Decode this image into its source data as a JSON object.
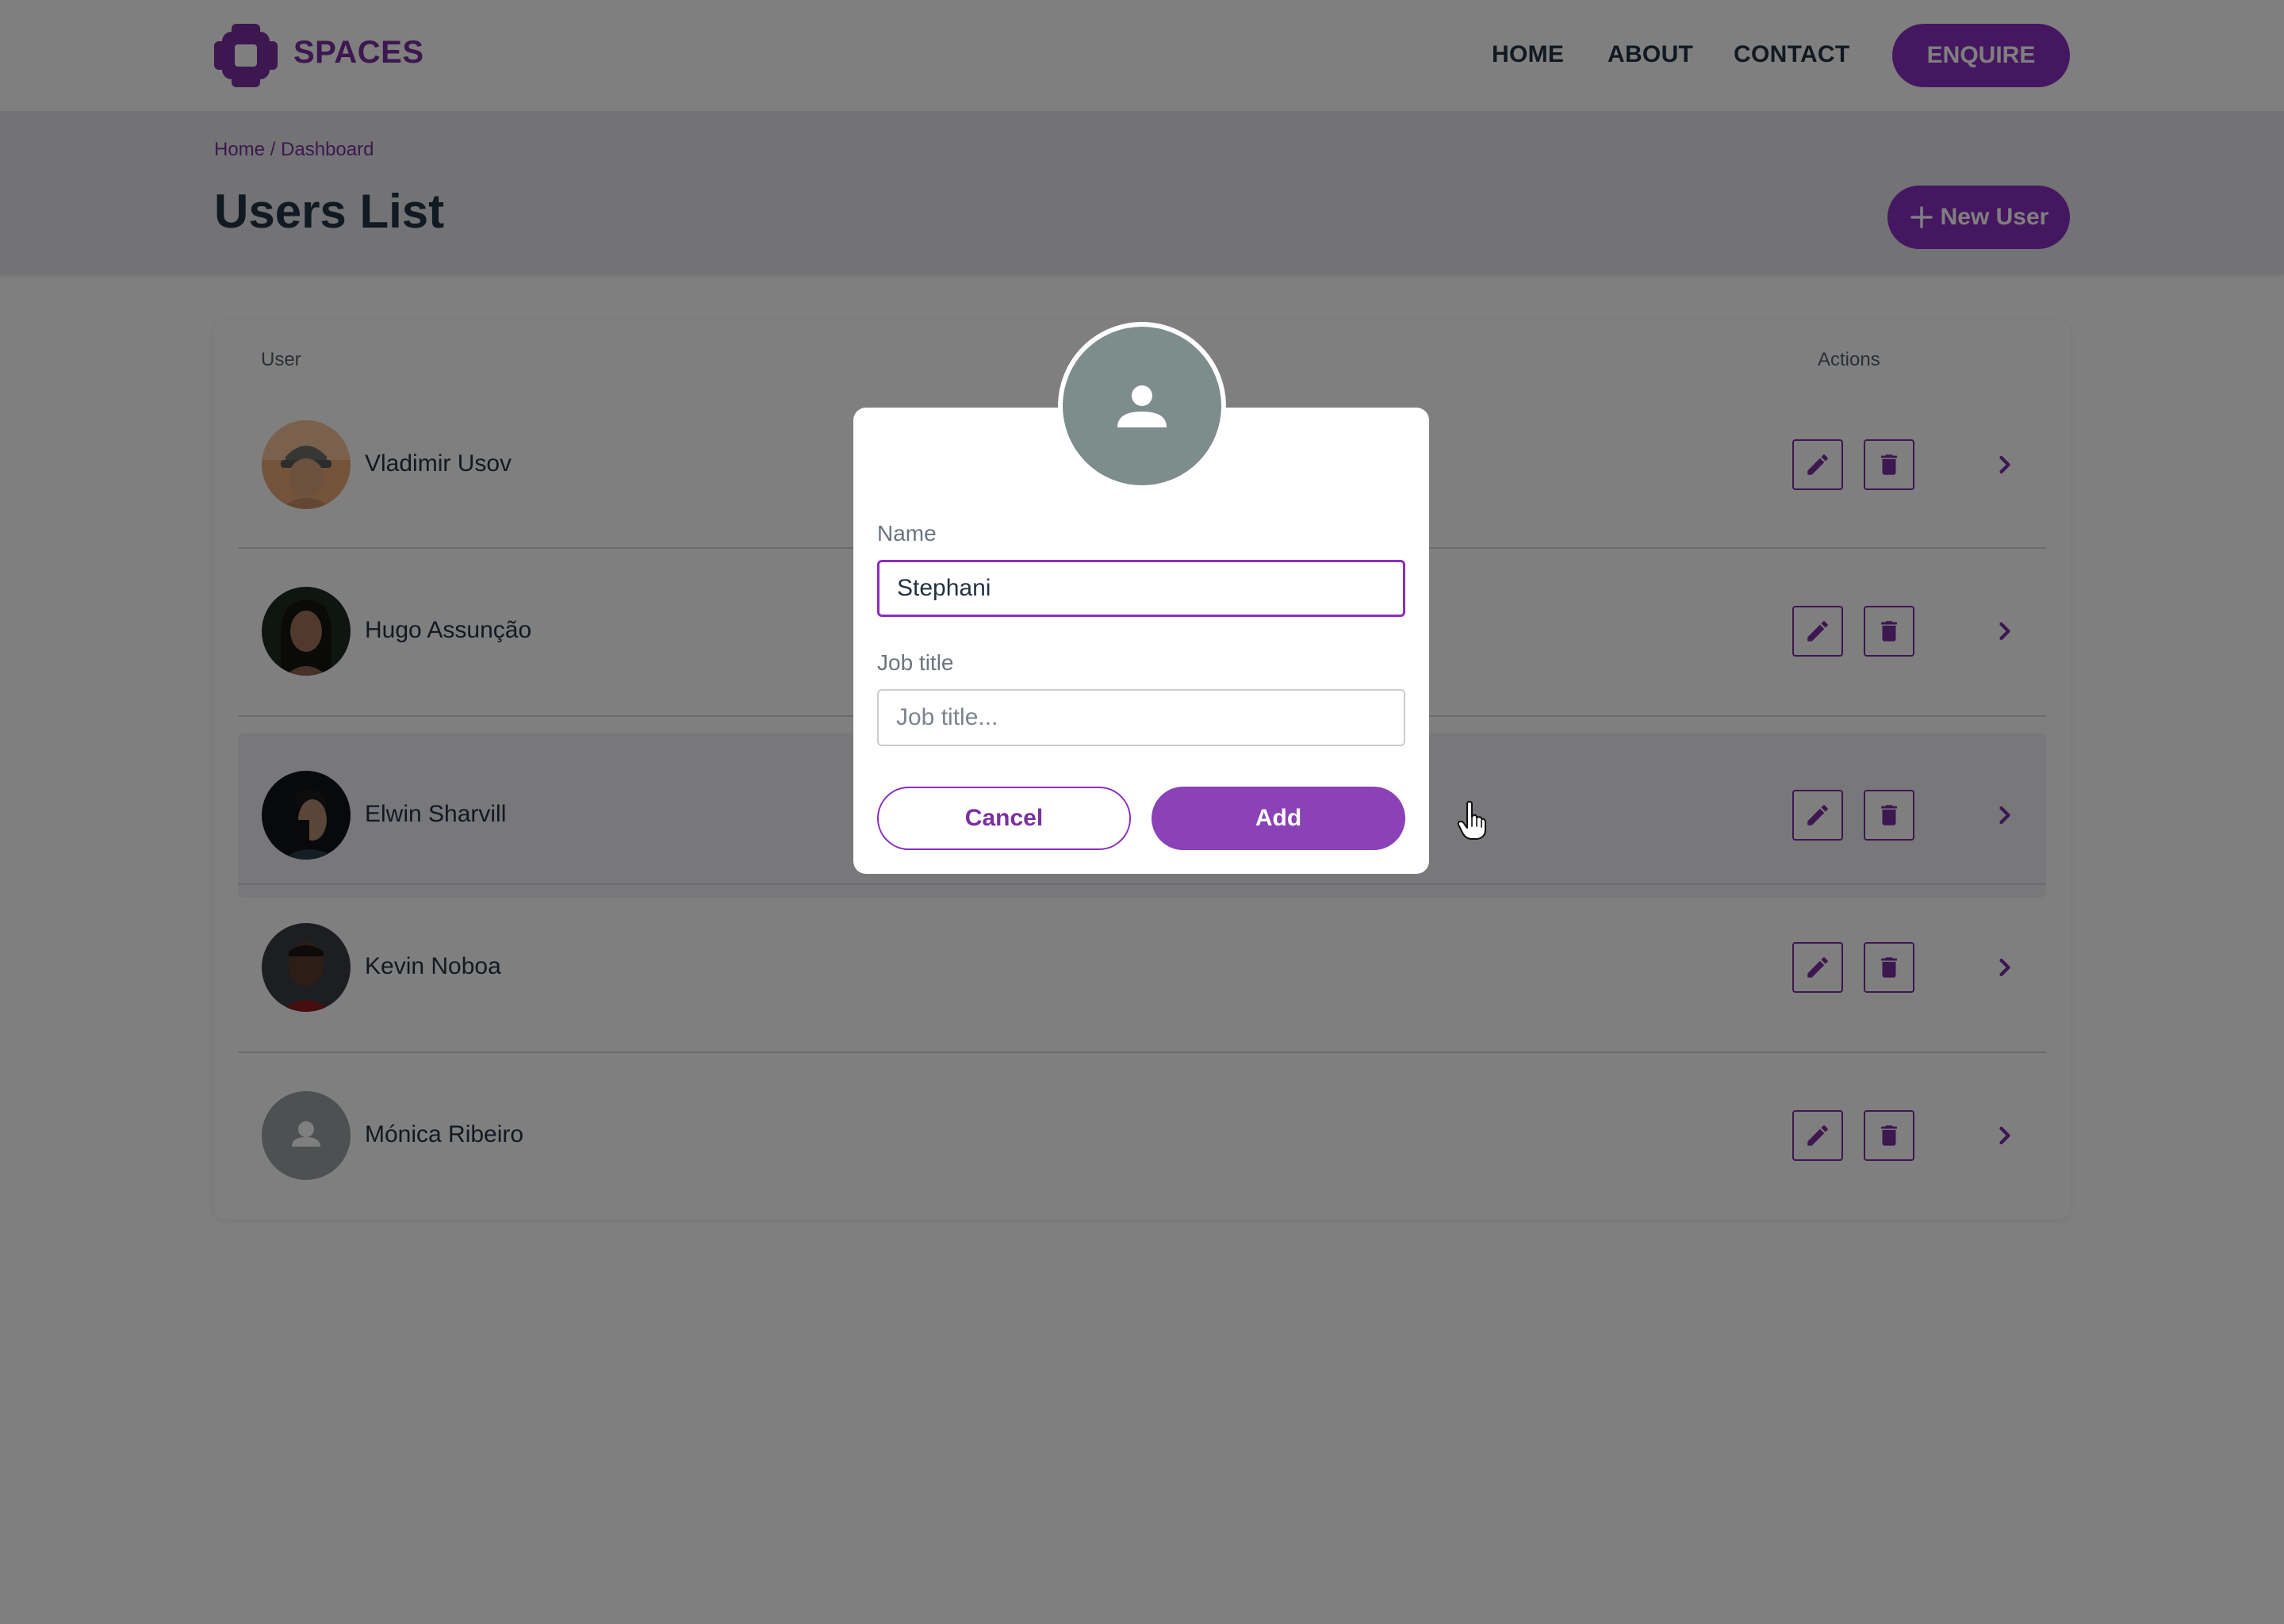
{
  "header": {
    "brand": "SPACES",
    "nav": [
      "HOME",
      "ABOUT",
      "CONTACT"
    ],
    "cta": "ENQUIRE"
  },
  "breadcrumb": {
    "home": "Home",
    "separator": " / ",
    "current": "Dashboard"
  },
  "page": {
    "title": "Users List",
    "new_user_label": "New User"
  },
  "table": {
    "headers": {
      "user": "User",
      "actions": "Actions"
    },
    "rows": [
      {
        "name": "Vladimir Usov"
      },
      {
        "name": "Hugo Assunção"
      },
      {
        "name": "Elwin Sharvill"
      },
      {
        "name": "Kevin Noboa"
      },
      {
        "name": "Mónica Ribeiro"
      }
    ]
  },
  "modal": {
    "name_label": "Name",
    "name_value": "Stephani",
    "job_label": "Job title",
    "job_placeholder": "Job title...",
    "cancel": "Cancel",
    "add": "Add"
  },
  "colors": {
    "accent": "#8a2ec0",
    "text": "#233244",
    "overlay": "rgba(0,0,0,0.5)",
    "modal_avatar": "#7d8d8c"
  },
  "icons": [
    "logo-icon",
    "plus-icon",
    "edit-icon",
    "trash-icon",
    "chevron-right-icon",
    "user-icon",
    "hand-cursor-icon"
  ]
}
